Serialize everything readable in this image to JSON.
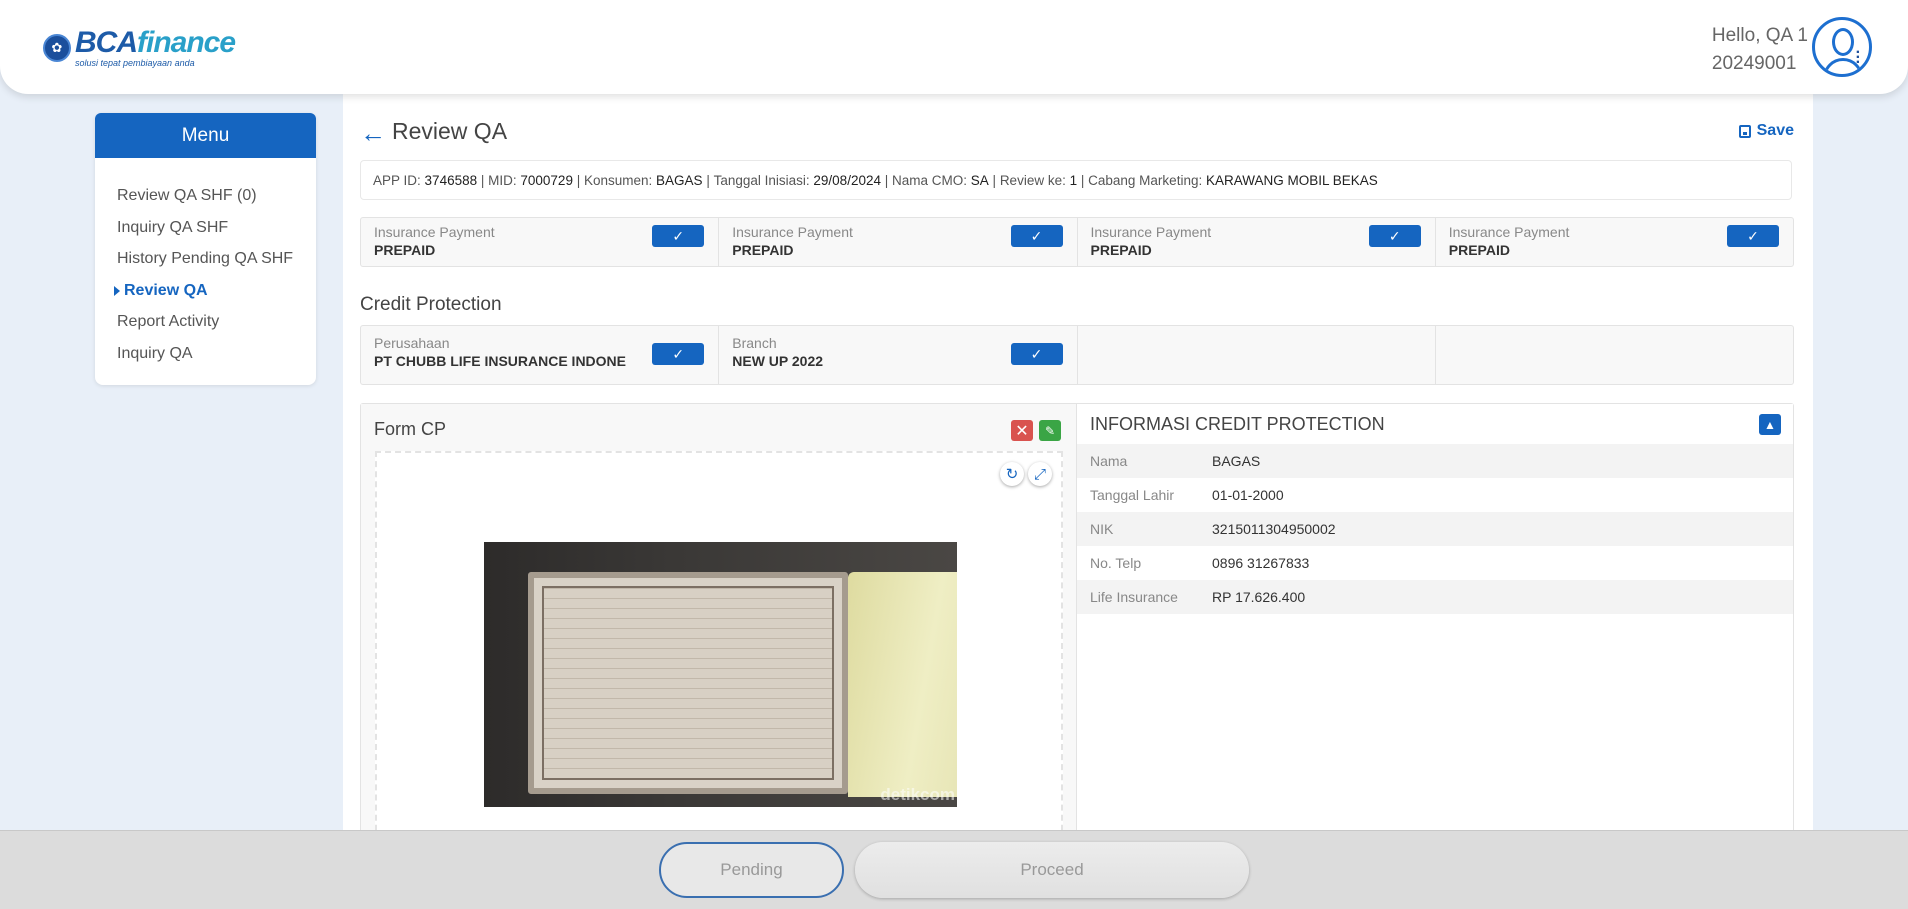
{
  "header": {
    "logo_main": "BCA",
    "logo_accent": "finance",
    "logo_tagline": "solusi tepat pembiayaan anda",
    "greeting": "Hello, QA 1",
    "user_id": "20249001"
  },
  "sidebar": {
    "title": "Menu",
    "items": [
      {
        "label": "Review QA SHF (0)"
      },
      {
        "label": "Inquiry QA SHF"
      },
      {
        "label": "History Pending QA SHF"
      },
      {
        "label": "Review QA"
      },
      {
        "label": "Report Activity"
      },
      {
        "label": "Inquiry QA"
      }
    ]
  },
  "page": {
    "title": "Review QA",
    "save_label": "Save"
  },
  "info_bar": {
    "app_id_label": "APP ID:",
    "app_id": "3746588",
    "mid_label": "MID:",
    "mid": "7000729",
    "konsumen_label": "Konsumen:",
    "konsumen": "BAGAS",
    "tanggal_label": "Tanggal Inisiasi:",
    "tanggal": "29/08/2024",
    "cmo_label": "Nama CMO:",
    "cmo": "SA",
    "review_label": "Review ke:",
    "review": "1",
    "cabang_label": "Cabang Marketing:",
    "cabang": "KARAWANG MOBIL BEKAS"
  },
  "insurance_row": [
    {
      "label": "Insurance Payment",
      "value": "PREPAID"
    },
    {
      "label": "Insurance Payment",
      "value": "PREPAID"
    },
    {
      "label": "Insurance Payment",
      "value": "PREPAID"
    },
    {
      "label": "Insurance Payment",
      "value": "PREPAID"
    }
  ],
  "credit_protection": {
    "title": "Credit Protection",
    "fields": [
      {
        "label": "Perusahaan",
        "value": "PT CHUBB LIFE INSURANCE INDONE"
      },
      {
        "label": "Branch",
        "value": "NEW UP 2022"
      }
    ]
  },
  "form_cp": {
    "title": "Form CP",
    "image_watermark": "detikcom"
  },
  "informasi_cp": {
    "title": "INFORMASI CREDIT PROTECTION",
    "rows": [
      {
        "key": "Nama",
        "value": "BAGAS"
      },
      {
        "key": "Tanggal Lahir",
        "value": "01-01-2000"
      },
      {
        "key": "NIK",
        "value": "3215011304950002"
      },
      {
        "key": "No. Telp",
        "value": "0896 31267833"
      },
      {
        "key": "Life Insurance",
        "value": "RP 17.626.400"
      }
    ]
  },
  "footer": {
    "pending_label": "Pending",
    "proceed_label": "Proceed"
  },
  "colors": {
    "primary": "#1565c0",
    "danger": "#d9534f",
    "success": "#3aa545"
  }
}
